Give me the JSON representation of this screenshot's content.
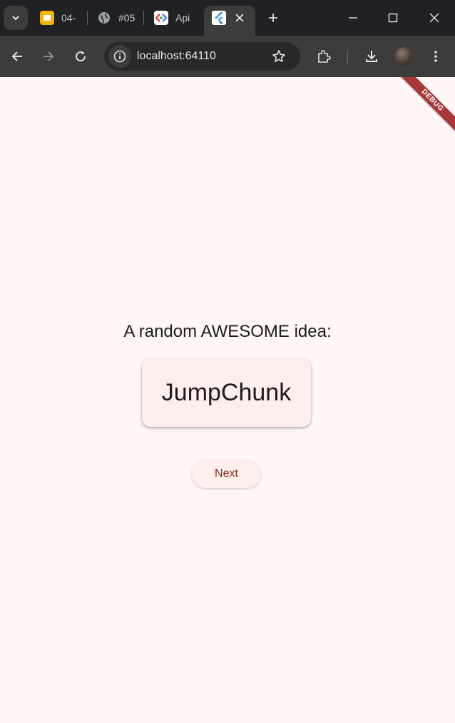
{
  "browser": {
    "tabs": [
      {
        "label": "04-",
        "icon": "slides-icon"
      },
      {
        "label": "#05",
        "icon": "globe-icon"
      },
      {
        "label": "Api",
        "icon": "colab-icon"
      },
      {
        "label": "",
        "icon": "flutter-icon",
        "active": true
      }
    ],
    "url": "localhost:64110"
  },
  "app": {
    "debug_banner": "DEBUG",
    "heading": "A random AWESOME idea:",
    "idea": "JumpChunk",
    "next_label": "Next"
  },
  "colors": {
    "background": "#fff8f6",
    "card": "#fcefec",
    "button_text": "#8c2a1c",
    "debug_banner": "#a83838"
  }
}
